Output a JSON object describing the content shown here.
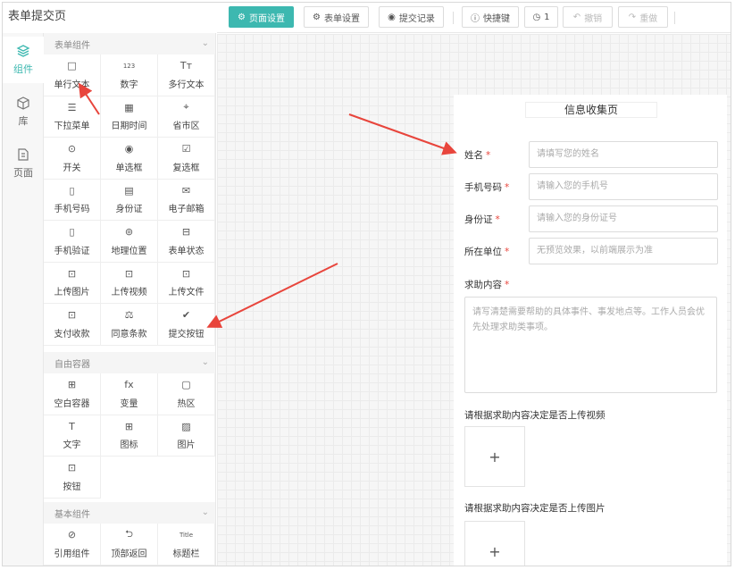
{
  "app": {
    "title": "表单提交页"
  },
  "toolbar": {
    "page_settings": "页面设置",
    "form_settings": "表单设置",
    "submit_records": "提交记录",
    "shortcuts": "快捷键",
    "history_count": "1",
    "undo": "撤销",
    "redo": "重做"
  },
  "rail": [
    {
      "label": "组件",
      "icon": "layers-icon"
    },
    {
      "label": "库",
      "icon": "box-icon"
    },
    {
      "label": "页面",
      "icon": "page-icon"
    }
  ],
  "sections": {
    "form": "表单组件",
    "free": "自由容器",
    "basic": "基本组件"
  },
  "form_components": [
    {
      "label": "单行文本",
      "icon": "□"
    },
    {
      "label": "数字",
      "icon": "123"
    },
    {
      "label": "多行文本",
      "icon": "Tт"
    },
    {
      "label": "下拉菜单",
      "icon": "☰"
    },
    {
      "label": "日期时间",
      "icon": "▦"
    },
    {
      "label": "省市区",
      "icon": "⌖"
    },
    {
      "label": "开关",
      "icon": "⊙"
    },
    {
      "label": "单选框",
      "icon": "◉"
    },
    {
      "label": "复选框",
      "icon": "☑"
    },
    {
      "label": "手机号码",
      "icon": "▯"
    },
    {
      "label": "身份证",
      "icon": "▤"
    },
    {
      "label": "电子邮箱",
      "icon": "✉"
    },
    {
      "label": "手机验证",
      "icon": "▯"
    },
    {
      "label": "地理位置",
      "icon": "⊚"
    },
    {
      "label": "表单状态",
      "icon": "⊟"
    },
    {
      "label": "上传图片",
      "icon": "⊡"
    },
    {
      "label": "上传视频",
      "icon": "⊡"
    },
    {
      "label": "上传文件",
      "icon": "⊡"
    },
    {
      "label": "支付收款",
      "icon": "⊡"
    },
    {
      "label": "同意条款",
      "icon": "⚖"
    },
    {
      "label": "提交按钮",
      "icon": "✔"
    }
  ],
  "free_components": [
    {
      "label": "空白容器",
      "icon": "⊞"
    },
    {
      "label": "变量",
      "icon": "fx"
    },
    {
      "label": "热区",
      "icon": "▢"
    },
    {
      "label": "文字",
      "icon": "T"
    },
    {
      "label": "图标",
      "icon": "⊞"
    },
    {
      "label": "图片",
      "icon": "▨"
    },
    {
      "label": "按钮",
      "icon": "⊡"
    }
  ],
  "basic_components": [
    {
      "label": "引用组件",
      "icon": "⊘"
    },
    {
      "label": "顶部返回",
      "icon": "⮌"
    },
    {
      "label": "标题栏",
      "icon": "Title"
    }
  ],
  "form_page": {
    "title": "信息收集页",
    "fields": [
      {
        "label": "姓名",
        "placeholder": "请填写您的姓名"
      },
      {
        "label": "手机号码",
        "placeholder": "请输入您的手机号"
      },
      {
        "label": "身份证",
        "placeholder": "请输入您的身份证号"
      },
      {
        "label": "所在单位",
        "placeholder": "无预览效果，以前端展示为准"
      }
    ],
    "help_label": "求助内容",
    "help_placeholder": "请写清楚需要帮助的具体事件、事发地点等。工作人员会优先处理求助类事项。",
    "video_label": "请根据求助内容决定是否上传视频",
    "image_label": "请根据求助内容决定是否上传图片",
    "upload_plus": "+",
    "required_mark": "*"
  },
  "colors": {
    "accent": "#3db8b0",
    "arrow": "#e8453c",
    "required": "#e8453c"
  }
}
